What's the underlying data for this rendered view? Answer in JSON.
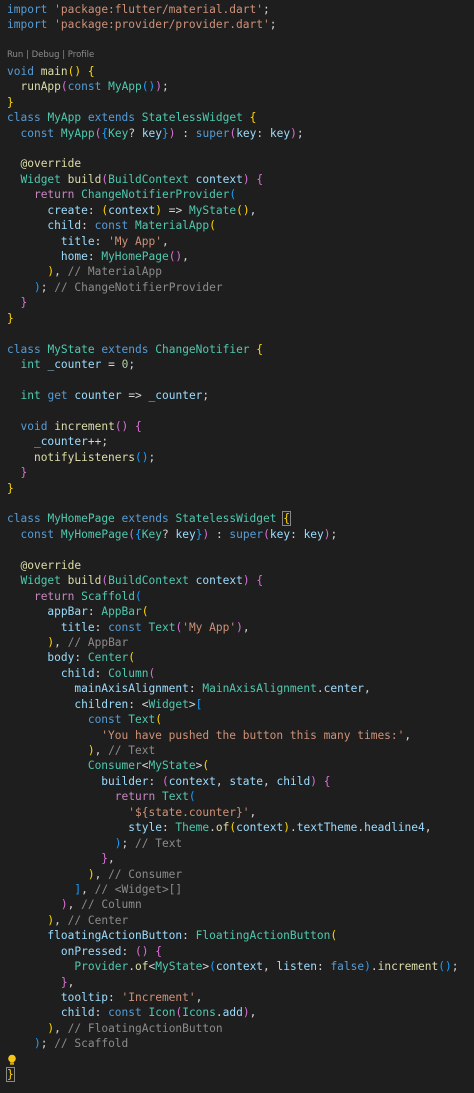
{
  "codelens": "Run | Debug | Profile",
  "lines": [
    [
      [
        "kw",
        "import"
      ],
      [
        "punc",
        " "
      ],
      [
        "str",
        "'package:flutter/material.dart'"
      ],
      [
        "punc",
        ";"
      ]
    ],
    [
      [
        "kw",
        "import"
      ],
      [
        "punc",
        " "
      ],
      [
        "str",
        "'package:provider/provider.dart'"
      ],
      [
        "punc",
        ";"
      ]
    ],
    [],
    "__LENS__",
    [
      [
        "kw",
        "void"
      ],
      [
        "punc",
        " "
      ],
      [
        "fn",
        "main"
      ],
      [
        "br1",
        "()"
      ],
      [
        "punc",
        " "
      ],
      [
        "br1",
        "{"
      ]
    ],
    [
      [
        "punc",
        "  "
      ],
      [
        "fn",
        "runApp"
      ],
      [
        "br2",
        "("
      ],
      [
        "kw",
        "const"
      ],
      [
        "punc",
        " "
      ],
      [
        "ty",
        "MyApp"
      ],
      [
        "br3",
        "()"
      ],
      [
        "br2",
        ")"
      ],
      [
        "punc",
        ";"
      ]
    ],
    [
      [
        "br1",
        "}"
      ]
    ],
    [
      [
        "kw",
        "class"
      ],
      [
        "punc",
        " "
      ],
      [
        "ty",
        "MyApp"
      ],
      [
        "punc",
        " "
      ],
      [
        "kw",
        "extends"
      ],
      [
        "punc",
        " "
      ],
      [
        "ty",
        "StatelessWidget"
      ],
      [
        "punc",
        " "
      ],
      [
        "br1",
        "{"
      ]
    ],
    [
      [
        "punc",
        "  "
      ],
      [
        "kw",
        "const"
      ],
      [
        "punc",
        " "
      ],
      [
        "ty",
        "MyApp"
      ],
      [
        "br2",
        "("
      ],
      [
        "br3",
        "{"
      ],
      [
        "ty",
        "Key"
      ],
      [
        "punc",
        "? "
      ],
      [
        "var",
        "key"
      ],
      [
        "br3",
        "}"
      ],
      [
        "br2",
        ")"
      ],
      [
        "punc",
        " : "
      ],
      [
        "kw",
        "super"
      ],
      [
        "br2",
        "("
      ],
      [
        "var",
        "key"
      ],
      [
        "punc",
        ": "
      ],
      [
        "var",
        "key"
      ],
      [
        "br2",
        ")"
      ],
      [
        "punc",
        ";"
      ]
    ],
    [],
    [
      [
        "punc",
        "  "
      ],
      [
        "fn",
        "@override"
      ]
    ],
    [
      [
        "punc",
        "  "
      ],
      [
        "ty",
        "Widget"
      ],
      [
        "punc",
        " "
      ],
      [
        "fn",
        "build"
      ],
      [
        "br2",
        "("
      ],
      [
        "ty",
        "BuildContext"
      ],
      [
        "punc",
        " "
      ],
      [
        "var",
        "context"
      ],
      [
        "br2",
        ")"
      ],
      [
        "punc",
        " "
      ],
      [
        "br2",
        "{"
      ]
    ],
    [
      [
        "punc",
        "    "
      ],
      [
        "ctl",
        "return"
      ],
      [
        "punc",
        " "
      ],
      [
        "ty",
        "ChangeNotifierProvider"
      ],
      [
        "br3",
        "("
      ]
    ],
    [
      [
        "punc",
        "      "
      ],
      [
        "var",
        "create"
      ],
      [
        "punc",
        ": "
      ],
      [
        "br1",
        "("
      ],
      [
        "var",
        "context"
      ],
      [
        "br1",
        ")"
      ],
      [
        "punc",
        " => "
      ],
      [
        "ty",
        "MyState"
      ],
      [
        "br1",
        "()"
      ],
      [
        "punc",
        ","
      ]
    ],
    [
      [
        "punc",
        "      "
      ],
      [
        "var",
        "child"
      ],
      [
        "punc",
        ": "
      ],
      [
        "kw",
        "const"
      ],
      [
        "punc",
        " "
      ],
      [
        "ty",
        "MaterialApp"
      ],
      [
        "br1",
        "("
      ]
    ],
    [
      [
        "punc",
        "        "
      ],
      [
        "var",
        "title"
      ],
      [
        "punc",
        ": "
      ],
      [
        "str",
        "'My App'"
      ],
      [
        "punc",
        ","
      ]
    ],
    [
      [
        "punc",
        "        "
      ],
      [
        "var",
        "home"
      ],
      [
        "punc",
        ": "
      ],
      [
        "ty",
        "MyHomePage"
      ],
      [
        "br2",
        "()"
      ],
      [
        "punc",
        ","
      ]
    ],
    [
      [
        "punc",
        "      "
      ],
      [
        "br1",
        ")"
      ],
      [
        "punc",
        ", "
      ],
      [
        "cm-gray",
        "// MaterialApp"
      ]
    ],
    [
      [
        "punc",
        "    "
      ],
      [
        "br3",
        ")"
      ],
      [
        "punc",
        "; "
      ],
      [
        "cm-gray",
        "// ChangeNotifierProvider"
      ]
    ],
    [
      [
        "punc",
        "  "
      ],
      [
        "br2",
        "}"
      ]
    ],
    [
      [
        "br1",
        "}"
      ]
    ],
    [],
    [
      [
        "kw",
        "class"
      ],
      [
        "punc",
        " "
      ],
      [
        "ty",
        "MyState"
      ],
      [
        "punc",
        " "
      ],
      [
        "kw",
        "extends"
      ],
      [
        "punc",
        " "
      ],
      [
        "ty",
        "ChangeNotifier"
      ],
      [
        "punc",
        " "
      ],
      [
        "br1",
        "{"
      ]
    ],
    [
      [
        "punc",
        "  "
      ],
      [
        "ty",
        "int"
      ],
      [
        "punc",
        " "
      ],
      [
        "var",
        "_counter"
      ],
      [
        "punc",
        " = "
      ],
      [
        "num",
        "0"
      ],
      [
        "punc",
        ";"
      ]
    ],
    [],
    [
      [
        "punc",
        "  "
      ],
      [
        "ty",
        "int"
      ],
      [
        "punc",
        " "
      ],
      [
        "kw",
        "get"
      ],
      [
        "punc",
        " "
      ],
      [
        "var",
        "counter"
      ],
      [
        "punc",
        " => "
      ],
      [
        "var",
        "_counter"
      ],
      [
        "punc",
        ";"
      ]
    ],
    [],
    [
      [
        "punc",
        "  "
      ],
      [
        "kw",
        "void"
      ],
      [
        "punc",
        " "
      ],
      [
        "fn",
        "increment"
      ],
      [
        "br2",
        "()"
      ],
      [
        "punc",
        " "
      ],
      [
        "br2",
        "{"
      ]
    ],
    [
      [
        "punc",
        "    "
      ],
      [
        "var",
        "_counter"
      ],
      [
        "punc",
        "++;"
      ]
    ],
    [
      [
        "punc",
        "    "
      ],
      [
        "fn",
        "notifyListeners"
      ],
      [
        "br3",
        "()"
      ],
      [
        "punc",
        ";"
      ]
    ],
    [
      [
        "punc",
        "  "
      ],
      [
        "br2",
        "}"
      ]
    ],
    [
      [
        "br1",
        "}"
      ]
    ],
    [],
    [
      [
        "kw",
        "class"
      ],
      [
        "punc",
        " "
      ],
      [
        "ty",
        "MyHomePage"
      ],
      [
        "punc",
        " "
      ],
      [
        "kw",
        "extends"
      ],
      [
        "punc",
        " "
      ],
      [
        "ty",
        "StatelessWidget"
      ],
      [
        "punc",
        " "
      ],
      [
        "br1",
        "{",
        "match"
      ]
    ],
    [
      [
        "punc",
        "  "
      ],
      [
        "kw",
        "const"
      ],
      [
        "punc",
        " "
      ],
      [
        "ty",
        "MyHomePage"
      ],
      [
        "br2",
        "("
      ],
      [
        "br3",
        "{"
      ],
      [
        "ty",
        "Key"
      ],
      [
        "punc",
        "? "
      ],
      [
        "var",
        "key"
      ],
      [
        "br3",
        "}"
      ],
      [
        "br2",
        ")"
      ],
      [
        "punc",
        " : "
      ],
      [
        "kw",
        "super"
      ],
      [
        "br2",
        "("
      ],
      [
        "var",
        "key"
      ],
      [
        "punc",
        ": "
      ],
      [
        "var",
        "key"
      ],
      [
        "br2",
        ")"
      ],
      [
        "punc",
        ";"
      ]
    ],
    [],
    [
      [
        "punc",
        "  "
      ],
      [
        "fn",
        "@override"
      ]
    ],
    [
      [
        "punc",
        "  "
      ],
      [
        "ty",
        "Widget"
      ],
      [
        "punc",
        " "
      ],
      [
        "fn",
        "build"
      ],
      [
        "br2",
        "("
      ],
      [
        "ty",
        "BuildContext"
      ],
      [
        "punc",
        " "
      ],
      [
        "var",
        "context"
      ],
      [
        "br2",
        ")"
      ],
      [
        "punc",
        " "
      ],
      [
        "br2",
        "{"
      ]
    ],
    [
      [
        "punc",
        "    "
      ],
      [
        "ctl",
        "return"
      ],
      [
        "punc",
        " "
      ],
      [
        "ty",
        "Scaffold"
      ],
      [
        "br3",
        "("
      ]
    ],
    [
      [
        "punc",
        "      "
      ],
      [
        "var",
        "appBar"
      ],
      [
        "punc",
        ": "
      ],
      [
        "ty",
        "AppBar"
      ],
      [
        "br1",
        "("
      ]
    ],
    [
      [
        "punc",
        "        "
      ],
      [
        "var",
        "title"
      ],
      [
        "punc",
        ": "
      ],
      [
        "kw",
        "const"
      ],
      [
        "punc",
        " "
      ],
      [
        "ty",
        "Text"
      ],
      [
        "br2",
        "("
      ],
      [
        "str",
        "'My App'"
      ],
      [
        "br2",
        ")"
      ],
      [
        "punc",
        ","
      ]
    ],
    [
      [
        "punc",
        "      "
      ],
      [
        "br1",
        ")"
      ],
      [
        "punc",
        ", "
      ],
      [
        "cm-gray",
        "// AppBar"
      ]
    ],
    [
      [
        "punc",
        "      "
      ],
      [
        "var",
        "body"
      ],
      [
        "punc",
        ": "
      ],
      [
        "ty",
        "Center"
      ],
      [
        "br1",
        "("
      ]
    ],
    [
      [
        "punc",
        "        "
      ],
      [
        "var",
        "child"
      ],
      [
        "punc",
        ": "
      ],
      [
        "ty",
        "Column"
      ],
      [
        "br2",
        "("
      ]
    ],
    [
      [
        "punc",
        "          "
      ],
      [
        "var",
        "mainAxisAlignment"
      ],
      [
        "punc",
        ": "
      ],
      [
        "ty",
        "MainAxisAlignment"
      ],
      [
        "punc",
        "."
      ],
      [
        "var",
        "center"
      ],
      [
        "punc",
        ","
      ]
    ],
    [
      [
        "punc",
        "          "
      ],
      [
        "var",
        "children"
      ],
      [
        "punc",
        ": <"
      ],
      [
        "ty",
        "Widget"
      ],
      [
        "punc",
        ">"
      ],
      [
        "br3",
        "["
      ]
    ],
    [
      [
        "punc",
        "            "
      ],
      [
        "kw",
        "const"
      ],
      [
        "punc",
        " "
      ],
      [
        "ty",
        "Text"
      ],
      [
        "br1",
        "("
      ]
    ],
    [
      [
        "punc",
        "              "
      ],
      [
        "str",
        "'You have pushed the button this many times:'"
      ],
      [
        "punc",
        ","
      ]
    ],
    [
      [
        "punc",
        "            "
      ],
      [
        "br1",
        ")"
      ],
      [
        "punc",
        ", "
      ],
      [
        "cm-gray",
        "// Text"
      ]
    ],
    [
      [
        "punc",
        "            "
      ],
      [
        "ty",
        "Consumer"
      ],
      [
        "punc",
        "<"
      ],
      [
        "ty",
        "MyState"
      ],
      [
        "punc",
        ">"
      ],
      [
        "br1",
        "("
      ]
    ],
    [
      [
        "punc",
        "              "
      ],
      [
        "var",
        "builder"
      ],
      [
        "punc",
        ": "
      ],
      [
        "br2",
        "("
      ],
      [
        "var",
        "context"
      ],
      [
        "punc",
        ", "
      ],
      [
        "var",
        "state"
      ],
      [
        "punc",
        ", "
      ],
      [
        "var",
        "child"
      ],
      [
        "br2",
        ")"
      ],
      [
        "punc",
        " "
      ],
      [
        "br2",
        "{"
      ]
    ],
    [
      [
        "punc",
        "                "
      ],
      [
        "ctl",
        "return"
      ],
      [
        "punc",
        " "
      ],
      [
        "ty",
        "Text"
      ],
      [
        "br3",
        "("
      ]
    ],
    [
      [
        "punc",
        "                  "
      ],
      [
        "str",
        "'${state.counter}'"
      ],
      [
        "punc",
        ","
      ]
    ],
    [
      [
        "punc",
        "                  "
      ],
      [
        "var",
        "style"
      ],
      [
        "punc",
        ": "
      ],
      [
        "ty",
        "Theme"
      ],
      [
        "punc",
        "."
      ],
      [
        "fn",
        "of"
      ],
      [
        "br1",
        "("
      ],
      [
        "var",
        "context"
      ],
      [
        "br1",
        ")"
      ],
      [
        "punc",
        "."
      ],
      [
        "var",
        "textTheme"
      ],
      [
        "punc",
        "."
      ],
      [
        "var",
        "headline4"
      ],
      [
        "punc",
        ","
      ]
    ],
    [
      [
        "punc",
        "                "
      ],
      [
        "br3",
        ")"
      ],
      [
        "punc",
        "; "
      ],
      [
        "cm-gray",
        "// Text"
      ]
    ],
    [
      [
        "punc",
        "              "
      ],
      [
        "br2",
        "}"
      ],
      [
        "punc",
        ","
      ]
    ],
    [
      [
        "punc",
        "            "
      ],
      [
        "br1",
        ")"
      ],
      [
        "punc",
        ", "
      ],
      [
        "cm-gray",
        "// Consumer"
      ]
    ],
    [
      [
        "punc",
        "          "
      ],
      [
        "br3",
        "]"
      ],
      [
        "punc",
        ", "
      ],
      [
        "cm-gray",
        "// <Widget>[]"
      ]
    ],
    [
      [
        "punc",
        "        "
      ],
      [
        "br2",
        ")"
      ],
      [
        "punc",
        ", "
      ],
      [
        "cm-gray",
        "// Column"
      ]
    ],
    [
      [
        "punc",
        "      "
      ],
      [
        "br1",
        ")"
      ],
      [
        "punc",
        ", "
      ],
      [
        "cm-gray",
        "// Center"
      ]
    ],
    [
      [
        "punc",
        "      "
      ],
      [
        "var",
        "floatingActionButton"
      ],
      [
        "punc",
        ": "
      ],
      [
        "ty",
        "FloatingActionButton"
      ],
      [
        "br1",
        "("
      ]
    ],
    [
      [
        "punc",
        "        "
      ],
      [
        "var",
        "onPressed"
      ],
      [
        "punc",
        ": "
      ],
      [
        "br2",
        "()"
      ],
      [
        "punc",
        " "
      ],
      [
        "br2",
        "{"
      ]
    ],
    [
      [
        "punc",
        "          "
      ],
      [
        "ty",
        "Provider"
      ],
      [
        "punc",
        "."
      ],
      [
        "fn",
        "of"
      ],
      [
        "punc",
        "<"
      ],
      [
        "ty",
        "MyState"
      ],
      [
        "punc",
        ">"
      ],
      [
        "br3",
        "("
      ],
      [
        "var",
        "context"
      ],
      [
        "punc",
        ", "
      ],
      [
        "var",
        "listen"
      ],
      [
        "punc",
        ": "
      ],
      [
        "kw",
        "false"
      ],
      [
        "br3",
        ")"
      ],
      [
        "punc",
        "."
      ],
      [
        "fn",
        "increment"
      ],
      [
        "br3",
        "()"
      ],
      [
        "punc",
        ";"
      ]
    ],
    [
      [
        "punc",
        "        "
      ],
      [
        "br2",
        "}"
      ],
      [
        "punc",
        ","
      ]
    ],
    [
      [
        "punc",
        "        "
      ],
      [
        "var",
        "tooltip"
      ],
      [
        "punc",
        ": "
      ],
      [
        "str",
        "'Increment'"
      ],
      [
        "punc",
        ","
      ]
    ],
    [
      [
        "punc",
        "        "
      ],
      [
        "var",
        "child"
      ],
      [
        "punc",
        ": "
      ],
      [
        "kw",
        "const"
      ],
      [
        "punc",
        " "
      ],
      [
        "ty",
        "Icon"
      ],
      [
        "br2",
        "("
      ],
      [
        "ty",
        "Icons"
      ],
      [
        "punc",
        "."
      ],
      [
        "var",
        "add"
      ],
      [
        "br2",
        ")"
      ],
      [
        "punc",
        ","
      ]
    ],
    [
      [
        "punc",
        "      "
      ],
      [
        "br1",
        ")"
      ],
      [
        "punc",
        ", "
      ],
      [
        "cm-gray",
        "// FloatingActionButton"
      ]
    ],
    [
      [
        "punc",
        "    "
      ],
      [
        "br3",
        ")"
      ],
      [
        "punc",
        "; "
      ],
      [
        "cm-gray",
        "// Scaffold"
      ]
    ],
    "__BULB__",
    "__LAST__"
  ],
  "last_line_text": "}",
  "icons": {
    "lightbulb": "lightbulb-icon"
  },
  "colors": {
    "background": "#1e1e1e",
    "keyword": "#569cd6",
    "control": "#c586c0",
    "type": "#4ec9b0",
    "function": "#dcdcaa",
    "variable": "#9cdcfe",
    "string": "#ce9178",
    "number": "#b5cea8",
    "comment": "#8b8b8b",
    "bracket1": "#ffd700",
    "bracket2": "#da70d6",
    "bracket3": "#179fff",
    "lightbulb": "#f5c518"
  }
}
